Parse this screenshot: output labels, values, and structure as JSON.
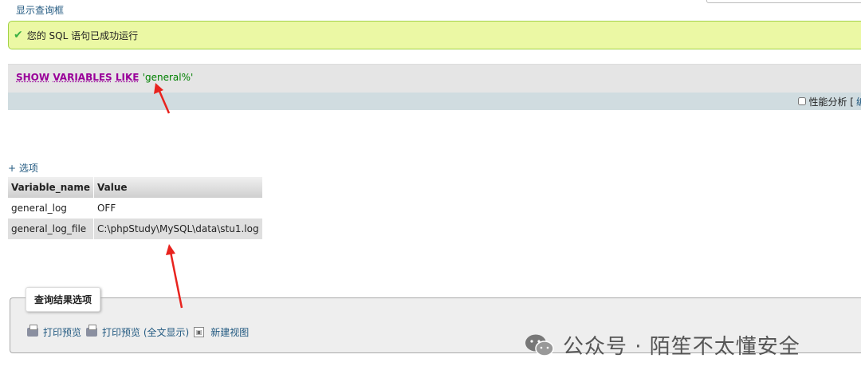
{
  "header": {
    "show_query_label": "显示查询框"
  },
  "success": {
    "message": "您的 SQL 语句已成功运行"
  },
  "sql": {
    "keywords": [
      "SHOW",
      "VARIABLES",
      "LIKE"
    ],
    "string_literal": "'general%'"
  },
  "toolbar": {
    "profiling_label": "性能分析 [",
    "edit_label": "编"
  },
  "options_link": "+ 选项",
  "results": {
    "columns": [
      "Variable_name",
      "Value"
    ],
    "rows": [
      [
        "general_log",
        "OFF"
      ],
      [
        "general_log_file",
        "C:\\phpStudy\\MySQL\\data\\stu1.log"
      ]
    ]
  },
  "result_options": {
    "legend": "查询结果选项",
    "actions": [
      "打印预览",
      "打印预览 (全文显示)",
      "新建视图"
    ]
  },
  "watermark": {
    "text": "公众号 · 陌笙不太懂安全"
  },
  "colors": {
    "accent_link": "#235a81",
    "success_bg": "#ebf8a4",
    "keyword": "#990099",
    "string": "#008000",
    "arrow": "#e8231e"
  }
}
